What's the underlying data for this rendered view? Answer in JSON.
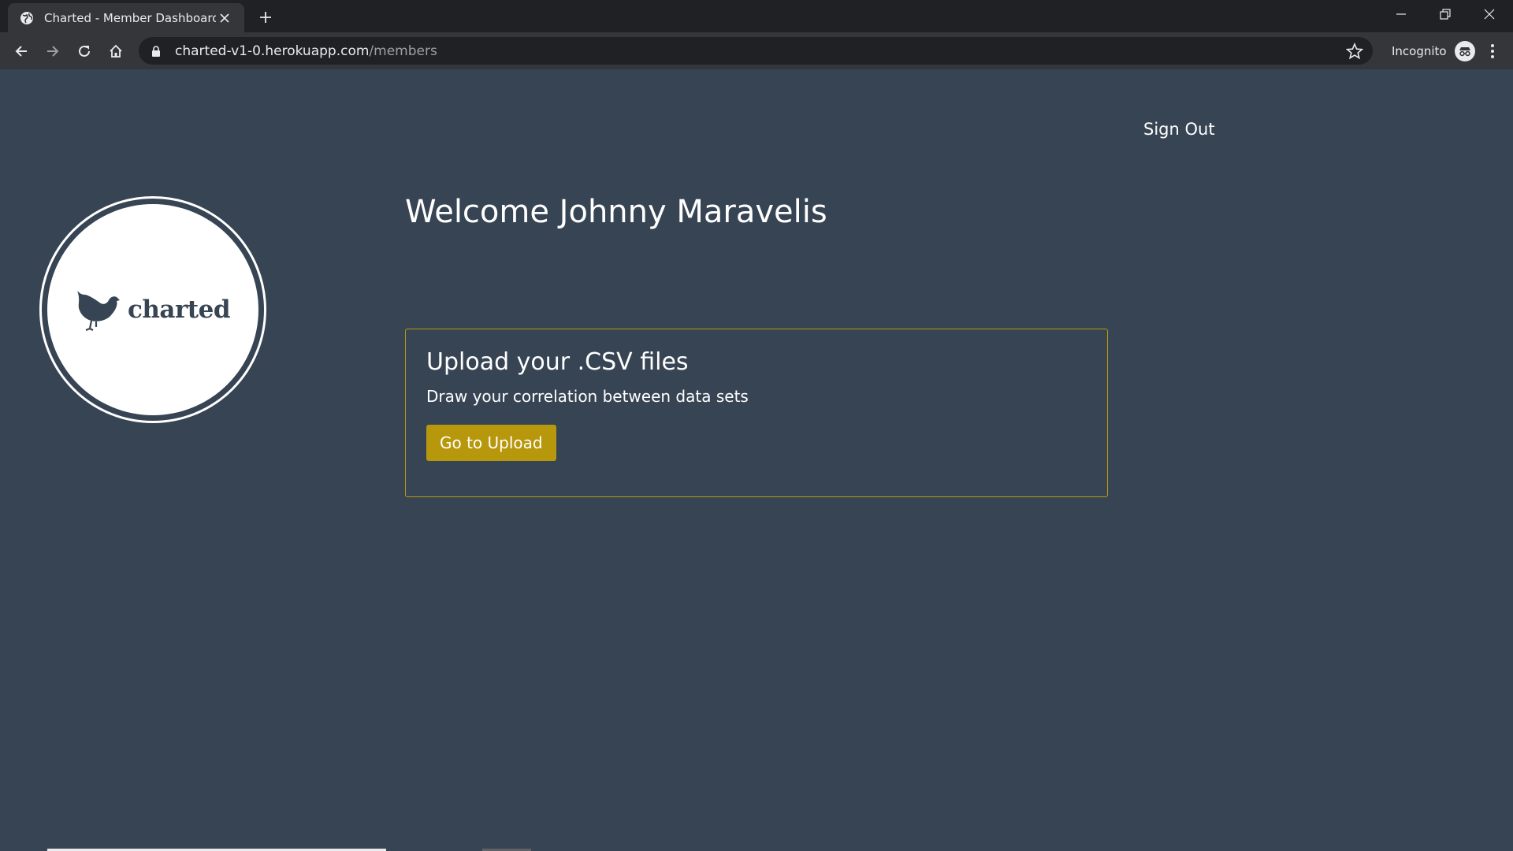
{
  "browser": {
    "tab_title": "Charted - Member Dashboard",
    "url_host": "charted-v1-0.herokuapp.com",
    "url_path": "/members",
    "profile_label": "Incognito",
    "icons": {
      "tab": "globe-icon",
      "close_tab": "close-icon",
      "new_tab": "plus-icon",
      "back": "back-arrow-icon",
      "forward": "forward-arrow-icon",
      "reload": "reload-icon",
      "home": "home-icon",
      "lock": "lock-icon",
      "bookmark": "star-icon",
      "profile": "incognito-icon",
      "menu": "kebab-menu-icon"
    }
  },
  "header": {
    "sign_out_label": "Sign Out"
  },
  "logo": {
    "wordmark": "charted",
    "icon": "chicken-icon"
  },
  "main": {
    "welcome_text": "Welcome Johnny Maravelis",
    "card": {
      "title": "Upload your .CSV files",
      "description": "Draw your correlation between data sets",
      "button_label": "Go to Upload"
    }
  },
  "colors": {
    "page_background": "#374453",
    "accent": "#b7970b",
    "card_border": "#b59a0f",
    "text": "#ffffff"
  }
}
